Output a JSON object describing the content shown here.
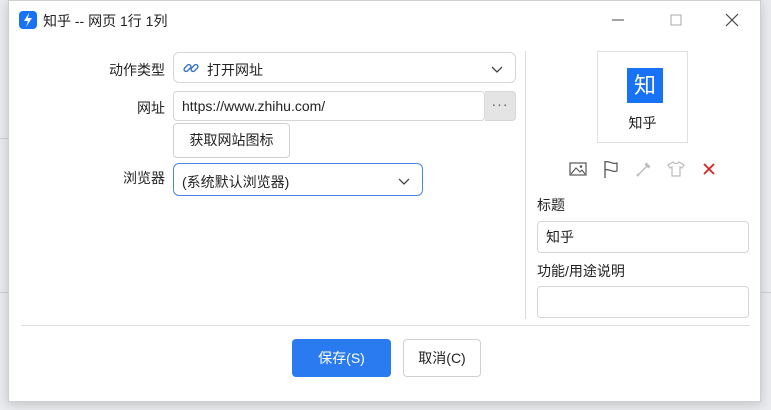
{
  "window": {
    "title": "知乎 -- 网页 1行 1列"
  },
  "form": {
    "action_type_label": "动作类型",
    "action_type_value": "打开网址",
    "url_label": "网址",
    "url_value": "https://www.zhihu.com/",
    "more_label": "···",
    "fetch_icon_label": "获取网站图标",
    "browser_label": "浏览器",
    "browser_value": "(系统默认浏览器)"
  },
  "preview": {
    "logo_text": "知",
    "label": "知乎"
  },
  "side": {
    "title_label": "标题",
    "title_value": "知乎",
    "desc_label": "功能/用途说明",
    "desc_value": ""
  },
  "footer": {
    "save_label": "保存(S)",
    "cancel_label": "取消(C)"
  },
  "colors": {
    "accent": "#2b7bf0",
    "brand": "#1772f6",
    "delete": "#e02020"
  },
  "icons": [
    "app-icon",
    "minimize-icon",
    "maximize-icon",
    "close-icon",
    "link-icon",
    "chevron-down-icon",
    "image-icon",
    "flag-icon",
    "eyedropper-icon",
    "shirt-icon",
    "delete-icon"
  ]
}
